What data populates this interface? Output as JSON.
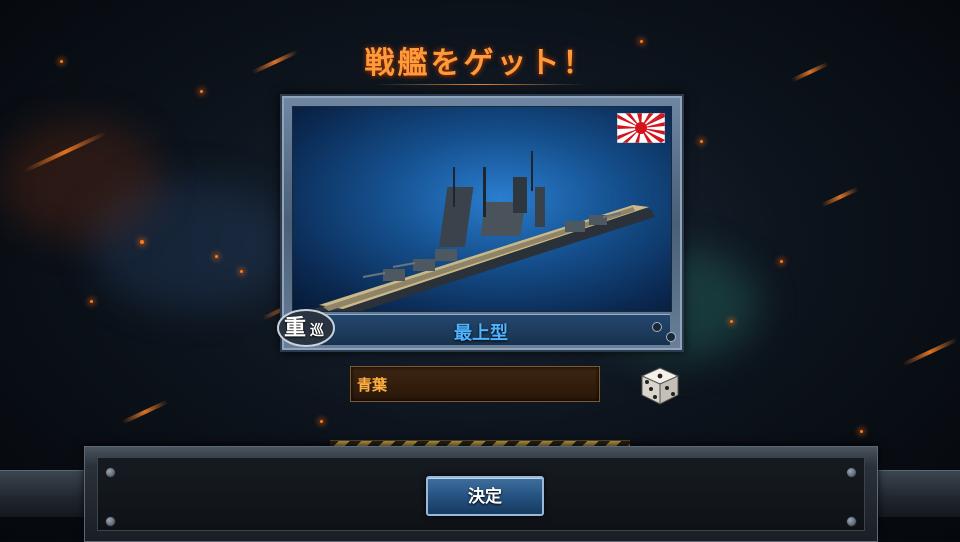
{
  "screen": {
    "title": "戦艦をゲット！"
  },
  "ship_card": {
    "class_name": "最上型",
    "type_badge": {
      "main": "重",
      "sub": "巡"
    },
    "flag_icon": "rising-sun-flag-icon",
    "ship_image": "heavy-cruiser-image"
  },
  "name_input": {
    "value": "青葉"
  },
  "random_button": {
    "icon": "dice-icon"
  },
  "footer": {
    "confirm_label": "決定"
  },
  "colors": {
    "title": "#ff9a3a",
    "name_text": "#4fb4ff",
    "input_text": "#ffb040",
    "button": "#23507e"
  }
}
